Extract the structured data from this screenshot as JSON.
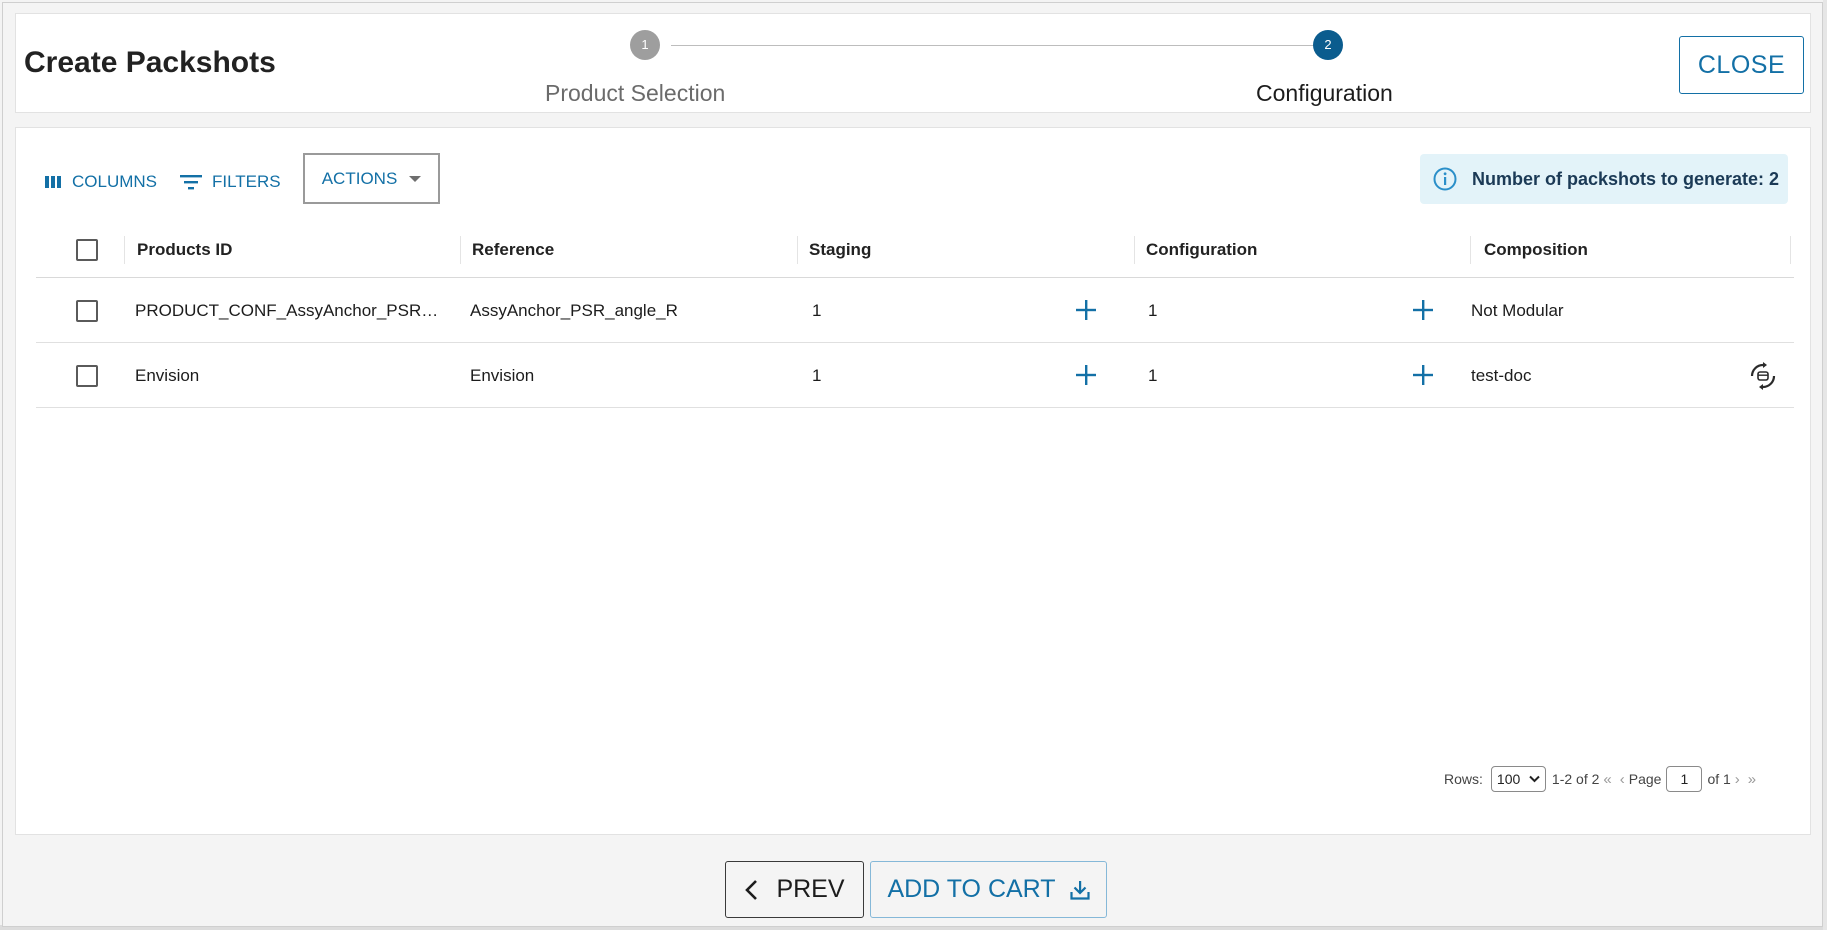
{
  "dialog": {
    "title": "Create Packshots",
    "close_label": "CLOSE"
  },
  "stepper": {
    "steps": [
      {
        "number": "1",
        "label": "Product Selection",
        "state": "completed"
      },
      {
        "number": "2",
        "label": "Configuration",
        "state": "active"
      }
    ],
    "colors": {
      "inactive": "#9e9e9e",
      "active": "#0b5c8e"
    }
  },
  "toolbar": {
    "columns_label": "COLUMNS",
    "filters_label": "FILTERS",
    "actions_label": "ACTIONS",
    "columns_icon": "columns-icon",
    "filters_icon": "filter-icon"
  },
  "info": {
    "text": "Number of packshots to generate: 2",
    "icon": "info-icon"
  },
  "table": {
    "headers": {
      "product_id": "Products ID",
      "reference": "Reference",
      "staging": "Staging",
      "configuration": "Configuration",
      "composition": "Composition"
    },
    "rows": [
      {
        "product_id": "PRODUCT_CONF_AssyAnchor_PSR…",
        "reference": "AssyAnchor_PSR_angle_R",
        "staging": "1",
        "configuration": "1",
        "composition": "Not Modular",
        "has_spinner": false
      },
      {
        "product_id": "Envision",
        "reference": "Envision",
        "staging": "1",
        "configuration": "1",
        "composition": "test-doc",
        "has_spinner": true
      }
    ]
  },
  "pagination": {
    "rows_label": "Rows:",
    "rows_value": "100",
    "range": "1-2 of 2",
    "page_label": "Page",
    "page_value": "1",
    "of_label": "of 1"
  },
  "footer": {
    "prev_label": "PREV",
    "cart_label": "ADD TO CART"
  },
  "colors": {
    "accent": "#1370a6",
    "info_bg": "#e3f3f9"
  }
}
